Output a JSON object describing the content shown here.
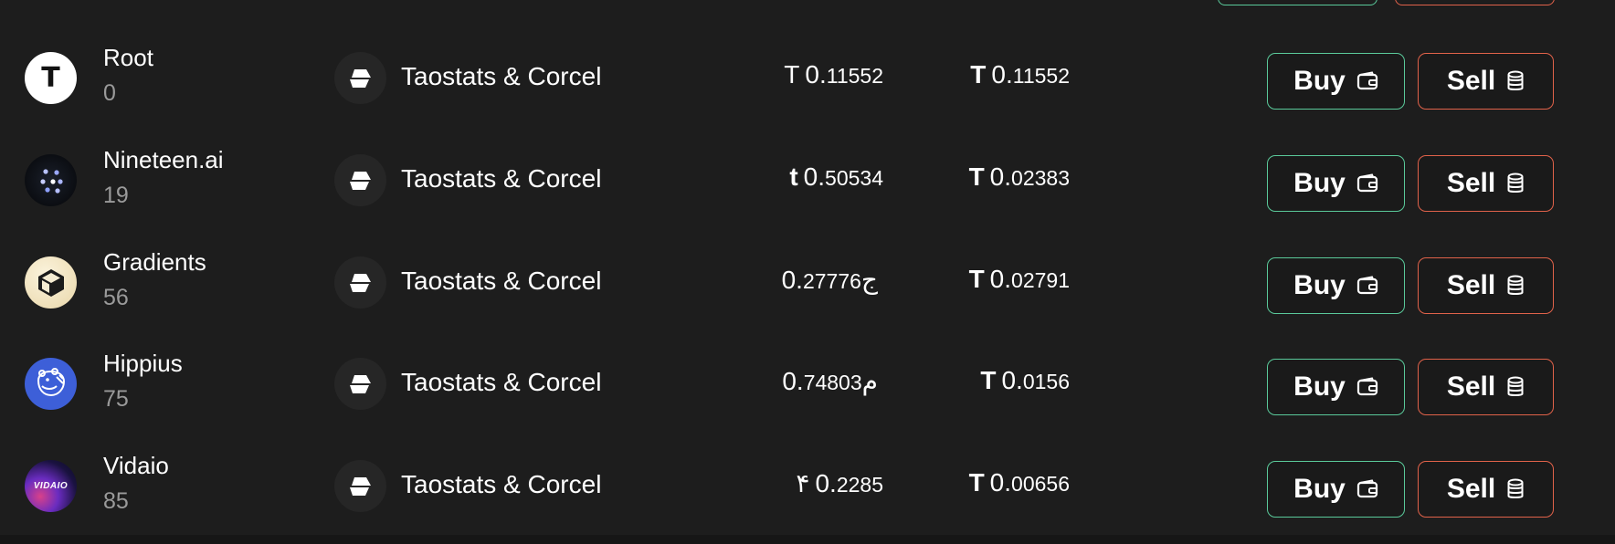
{
  "rows": [
    {
      "name": "Root",
      "id": "0",
      "logo_icon": "tao-icon",
      "validator": "Taostats & Corcel",
      "price_symbol": "Τ",
      "price_int": "0.",
      "price_dec": "11552",
      "value_symbol": "Τ",
      "value_int": "0.",
      "value_dec": "11552",
      "buy_label": "Buy",
      "sell_label": "Sell"
    },
    {
      "name": "Nineteen.ai",
      "id": "19",
      "logo_icon": "dots-icon",
      "validator": "Taostats & Corcel",
      "price_symbol": "t",
      "price_int": "0.",
      "price_dec": "50534",
      "value_symbol": "Τ",
      "value_int": "0.",
      "value_dec": "02383",
      "buy_label": "Buy",
      "sell_label": "Sell"
    },
    {
      "name": "Gradients",
      "id": "56",
      "logo_icon": "cube-icon",
      "validator": "Taostats & Corcel",
      "price_symbol": "ج",
      "price_int": "0.",
      "price_dec": "27776",
      "value_symbol": "Τ",
      "value_int": "0.",
      "value_dec": "02791",
      "buy_label": "Buy",
      "sell_label": "Sell"
    },
    {
      "name": "Hippius",
      "id": "75",
      "logo_icon": "hippo-icon",
      "validator": "Taostats & Corcel",
      "price_symbol": "م",
      "price_int": "0.",
      "price_dec": "74803",
      "value_symbol": "Τ",
      "value_int": "0.",
      "value_dec": "0156",
      "buy_label": "Buy",
      "sell_label": "Sell"
    },
    {
      "name": "Vidaio",
      "id": "85",
      "logo_icon": "vidaio-icon",
      "validator": "Taostats & Corcel",
      "price_symbol": "۴",
      "price_int": "0.",
      "price_dec": "2285",
      "value_symbol": "Τ",
      "value_int": "0.",
      "value_dec": "00656",
      "buy_label": "Buy",
      "sell_label": "Sell"
    }
  ],
  "logo_text": {
    "root": "Τ",
    "vidaio": "VIDAIO"
  },
  "colors": {
    "background": "#1d1d1d",
    "buy_border": "#5ac99a",
    "sell_border": "#e0624a",
    "muted_text": "#9a9a9a",
    "hippius_blue": "#3d5fd8",
    "gradients_cream": "#f1e4c2"
  }
}
